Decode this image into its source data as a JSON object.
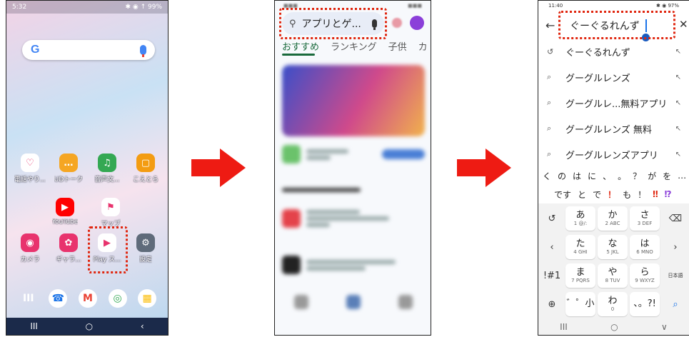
{
  "phone1": {
    "status_time": "5:32",
    "status_icons": "▣ ⚙ ⚙ •",
    "status_right": "✱ ◉ ↑ 99%",
    "google_logo": "G",
    "apps_row1": [
      {
        "label": "電話やり...",
        "icon": "heart-phone-icon",
        "color": "#ffffff",
        "glyph": "♡"
      },
      {
        "label": "UDトーク",
        "icon": "chat-bubble-icon",
        "color": "#f5a623",
        "glyph": "…"
      },
      {
        "label": "音声文...",
        "icon": "voice-text-icon",
        "color": "#34a853",
        "glyph": "♫"
      },
      {
        "label": "こえとら",
        "icon": "koetora-icon",
        "color": "#f39c12",
        "glyph": "▢"
      }
    ],
    "apps_row2": [
      {
        "label": "YouTube",
        "icon": "youtube-icon",
        "color": "#ff0000",
        "glyph": "▶"
      },
      {
        "label": "マップ",
        "icon": "maps-icon",
        "color": "#ffffff",
        "glyph": "⚑"
      }
    ],
    "apps_row3": [
      {
        "label": "カメラ",
        "icon": "camera-icon",
        "color": "#e8336d",
        "glyph": "◉"
      },
      {
        "label": "ギャラ...",
        "icon": "gallery-icon",
        "color": "#e8336d",
        "glyph": "✿"
      },
      {
        "label": "Play ス...",
        "icon": "play-store-icon",
        "color": "#ffffff",
        "glyph": "▶"
      },
      {
        "label": "設定",
        "icon": "settings-icon",
        "color": "#5f6b7a",
        "glyph": "⚙"
      }
    ],
    "dock": [
      {
        "icon": "recents-icon",
        "glyph": "III",
        "bg": "transparent",
        "fg": "#ffffff"
      },
      {
        "icon": "phone-icon",
        "glyph": "☎",
        "bg": "#ffffff",
        "fg": "#1a73e8"
      },
      {
        "icon": "gmail-icon",
        "glyph": "M",
        "bg": "#ffffff",
        "fg": "#ea4335"
      },
      {
        "icon": "chrome-icon",
        "glyph": "◎",
        "bg": "#ffffff",
        "fg": "#34a853"
      },
      {
        "icon": "calendar-icon",
        "glyph": "▦",
        "bg": "#ffffff",
        "fg": "#fbbc05"
      }
    ],
    "nav": [
      "III",
      "○",
      "‹"
    ]
  },
  "phone2": {
    "search_text": "アプリとゲ...",
    "tabs": [
      "おすすめ",
      "ランキング",
      "子供",
      "カ"
    ],
    "active_tab": 0
  },
  "phone3": {
    "status_time": "11:40",
    "status_right": "✱ ◉ 97%",
    "query": "ぐーぐるれんず",
    "suggestions": [
      {
        "icon": "history-icon",
        "glyph": "↺",
        "text": "ぐーぐるれんず"
      },
      {
        "icon": "search-icon",
        "glyph": "⌕",
        "text": "グーグルレンズ"
      },
      {
        "icon": "search-icon",
        "glyph": "⌕",
        "text": "グーグルレ...無料アプリ"
      },
      {
        "icon": "search-icon",
        "glyph": "⌕",
        "text": "グーグルレンズ 無料"
      },
      {
        "icon": "search-icon",
        "glyph": "⌕",
        "text": "グーグルレンズアプリ"
      }
    ],
    "candidates_row1": [
      "く",
      "の",
      "は",
      "に",
      "、",
      "。",
      "？",
      "が",
      "を",
      "…"
    ],
    "candidates_row2": [
      {
        "t": "です",
        "c": ""
      },
      {
        "t": "と",
        "c": ""
      },
      {
        "t": "で",
        "c": ""
      },
      {
        "t": "！",
        "c": "red"
      },
      {
        "t": "も",
        "c": ""
      },
      {
        "t": "！",
        "c": ""
      },
      {
        "t": "‼",
        "c": "red"
      },
      {
        "t": "⁉",
        "c": "purple"
      }
    ],
    "keys": {
      "r1": [
        {
          "m": "あ",
          "s": "1  @/:"
        },
        {
          "m": "か",
          "s": "2  ABC"
        },
        {
          "m": "さ",
          "s": "3  DEF"
        }
      ],
      "r2": [
        {
          "m": "た",
          "s": "4  GHI"
        },
        {
          "m": "な",
          "s": "5  JKL"
        },
        {
          "m": "は",
          "s": "6  MNO"
        }
      ],
      "r3": [
        {
          "m": "ま",
          "s": "7  PQRS"
        },
        {
          "m": "や",
          "s": "8  TUV"
        },
        {
          "m": "ら",
          "s": "9  WXYZ"
        }
      ],
      "r4": [
        {
          "m": "゛゜小",
          "s": ""
        },
        {
          "m": "わ",
          "s": "0"
        },
        {
          "m": "、。?!",
          "s": ""
        }
      ]
    },
    "side_keys": {
      "undo": "↺",
      "backspace": "⌫",
      "left": "‹",
      "right": "›",
      "symbols": "!#1",
      "lang": "日本語",
      "globe": "⊕",
      "search": "⌕"
    },
    "nav": [
      "III",
      "○",
      "∨"
    ]
  }
}
